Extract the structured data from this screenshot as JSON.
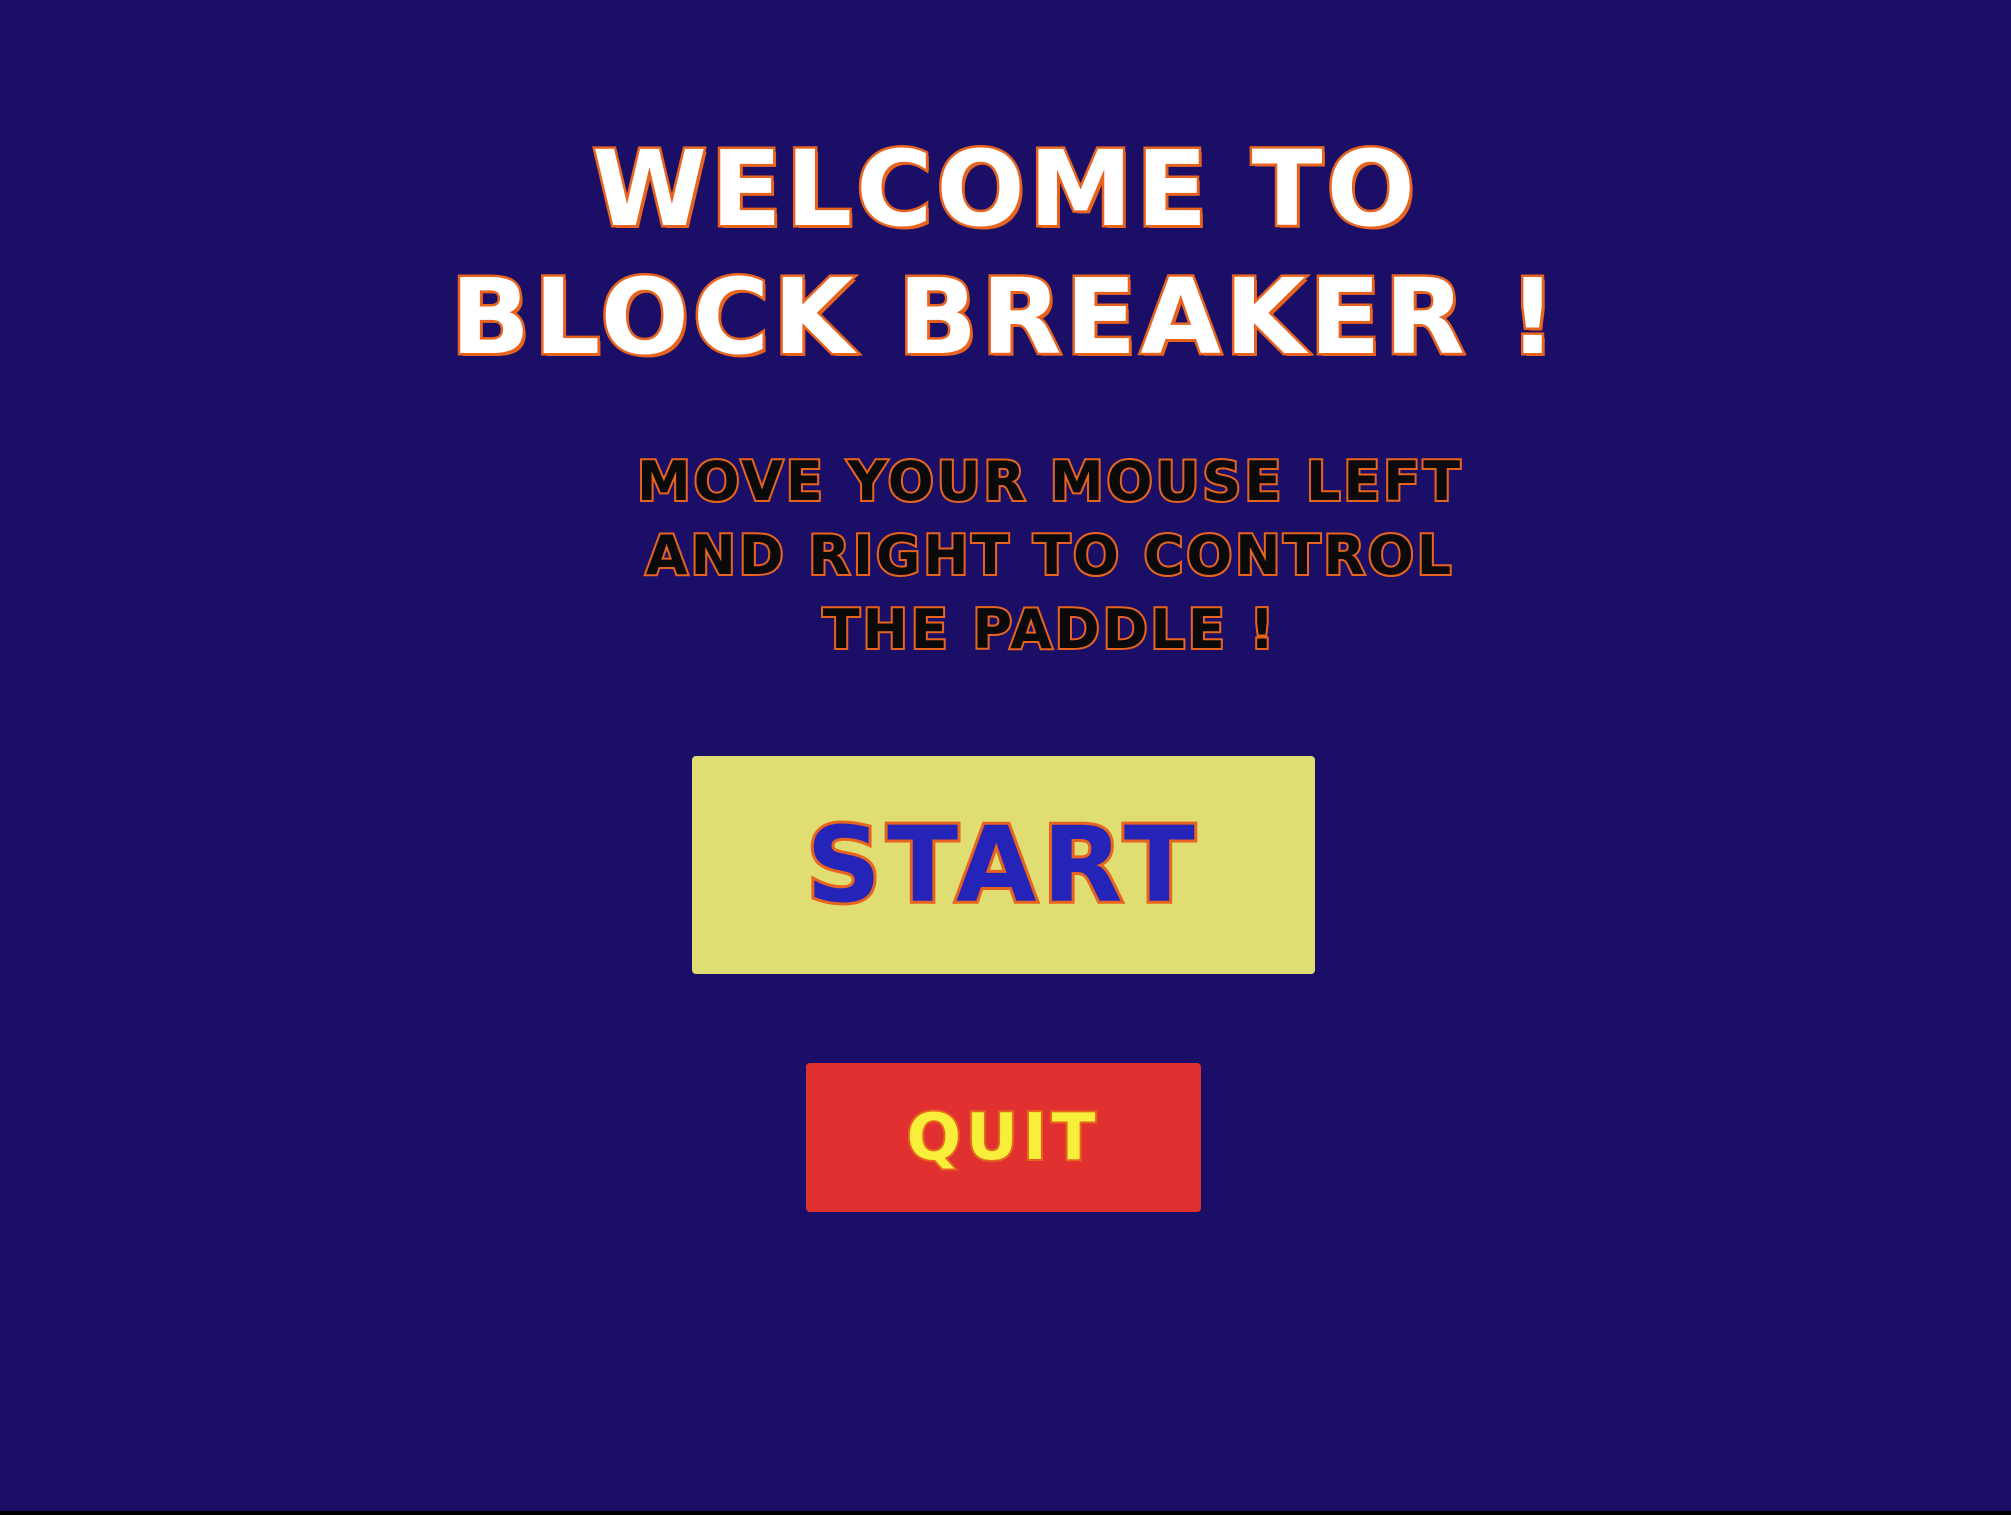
{
  "title": {
    "line1": "WELCOME TO",
    "line2": "BLOCK BREAKER !"
  },
  "instructions": {
    "line1": "MOVE YOUR MOUSE LEFT",
    "line2": "AND RIGHT TO CONTROL",
    "line3": "THE PADDLE !"
  },
  "buttons": {
    "start_label": "START",
    "quit_label": "QUIT"
  },
  "colors": {
    "background": "#1b0e66",
    "title_text": "#ffffff",
    "text_outline": "#e8641e",
    "instructions_text": "#0a0a0a",
    "start_button_bg": "#e0dd72",
    "start_text": "#2524b8",
    "quit_button_bg": "#e03030",
    "quit_text": "#f7ef3a"
  }
}
